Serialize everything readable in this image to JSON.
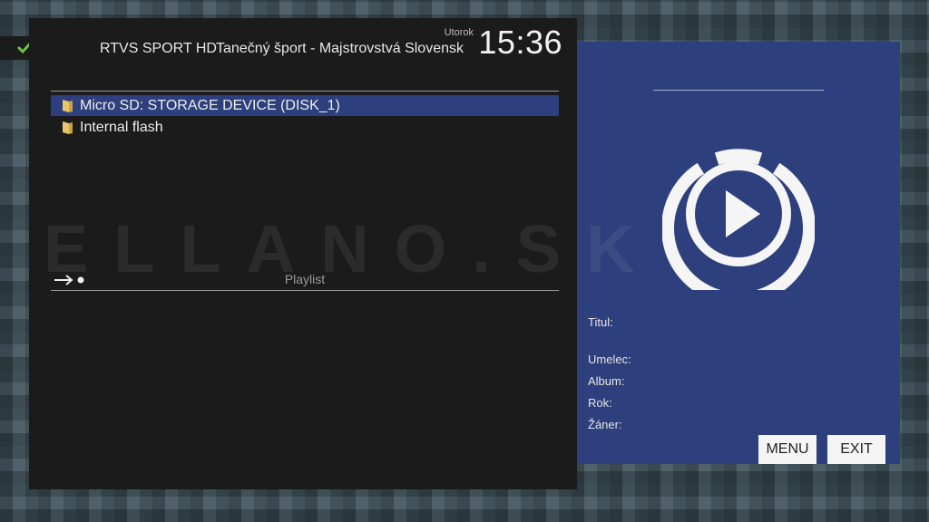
{
  "status": {
    "dash": "-"
  },
  "header": {
    "channel": "RTVS SPORT HD",
    "program": "Tanečný šport - Majstrovstvá Slovensk",
    "day": "Utorok",
    "time": "15:36"
  },
  "file_list": {
    "items": [
      {
        "label": "Micro SD: STORAGE DEVICE (DISK_1)",
        "selected": true,
        "icon": "folder-icon"
      },
      {
        "label": "Internal flash",
        "selected": false,
        "icon": "folder-icon"
      }
    ]
  },
  "playlist": {
    "label": "Playlist",
    "icon": "arrow-dot-icon"
  },
  "watermark": "ELLANO.SK",
  "info": {
    "title_label": "Titul:",
    "artist_label": "Umelec:",
    "album_label": "Album:",
    "year_label": "Rok:",
    "genre_label": "Žáner:"
  },
  "buttons": {
    "menu": "MENU",
    "exit": "EXIT"
  },
  "colors": {
    "panel_bg": "#1b1b1b",
    "accent_blue": "#2d3f7c",
    "check_green": "#6fc04b"
  }
}
